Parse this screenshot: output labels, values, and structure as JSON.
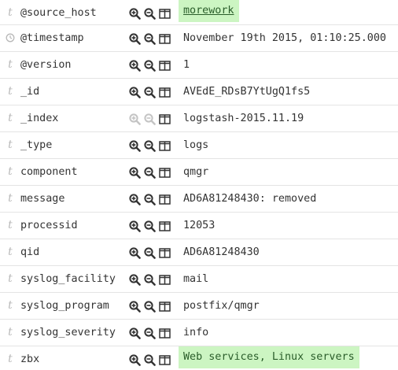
{
  "rows": [
    {
      "type": "string",
      "type_icon_text": "t",
      "name": "@source_host",
      "value": "morework",
      "highlight": true,
      "link": true,
      "filter_enabled": true
    },
    {
      "type": "date",
      "type_icon_text": "",
      "name": "@timestamp",
      "value": "November 19th 2015, 01:10:25.000",
      "highlight": false,
      "link": false,
      "filter_enabled": true
    },
    {
      "type": "string",
      "type_icon_text": "t",
      "name": "@version",
      "value": "1",
      "highlight": false,
      "link": false,
      "filter_enabled": true
    },
    {
      "type": "string",
      "type_icon_text": "t",
      "name": "_id",
      "value": "AVEdE_RDsB7YtUgQ1fs5",
      "highlight": false,
      "link": false,
      "filter_enabled": true
    },
    {
      "type": "string",
      "type_icon_text": "t",
      "name": "_index",
      "value": "logstash-2015.11.19",
      "highlight": false,
      "link": false,
      "filter_enabled": false
    },
    {
      "type": "string",
      "type_icon_text": "t",
      "name": "_type",
      "value": "logs",
      "highlight": false,
      "link": false,
      "filter_enabled": true
    },
    {
      "type": "string",
      "type_icon_text": "t",
      "name": "component",
      "value": "qmgr",
      "highlight": false,
      "link": false,
      "filter_enabled": true
    },
    {
      "type": "string",
      "type_icon_text": "t",
      "name": "message",
      "value": "AD6A81248430: removed",
      "highlight": false,
      "link": false,
      "filter_enabled": true
    },
    {
      "type": "string",
      "type_icon_text": "t",
      "name": "processid",
      "value": "12053",
      "highlight": false,
      "link": false,
      "filter_enabled": true
    },
    {
      "type": "string",
      "type_icon_text": "t",
      "name": "qid",
      "value": "AD6A81248430",
      "highlight": false,
      "link": false,
      "filter_enabled": true
    },
    {
      "type": "string",
      "type_icon_text": "t",
      "name": "syslog_facility",
      "value": "mail",
      "highlight": false,
      "link": false,
      "filter_enabled": true
    },
    {
      "type": "string",
      "type_icon_text": "t",
      "name": "syslog_program",
      "value": "postfix/qmgr",
      "highlight": false,
      "link": false,
      "filter_enabled": true
    },
    {
      "type": "string",
      "type_icon_text": "t",
      "name": "syslog_severity",
      "value": "info",
      "highlight": false,
      "link": false,
      "filter_enabled": true
    },
    {
      "type": "string",
      "type_icon_text": "t",
      "name": "zbx",
      "value": "Web services, Linux servers",
      "highlight": true,
      "link": false,
      "filter_enabled": true
    }
  ],
  "icons": {
    "filter_for": "magnifier-plus-icon",
    "filter_out": "magnifier-minus-icon",
    "toggle_column": "column-toggle-icon",
    "date_type": "clock-icon",
    "string_type": "string-type-icon"
  },
  "colors": {
    "highlight_bg": "#ccf5c2",
    "icon_dark": "#333333",
    "icon_muted": "#b8b8b8",
    "row_border": "#e4e4e4"
  }
}
